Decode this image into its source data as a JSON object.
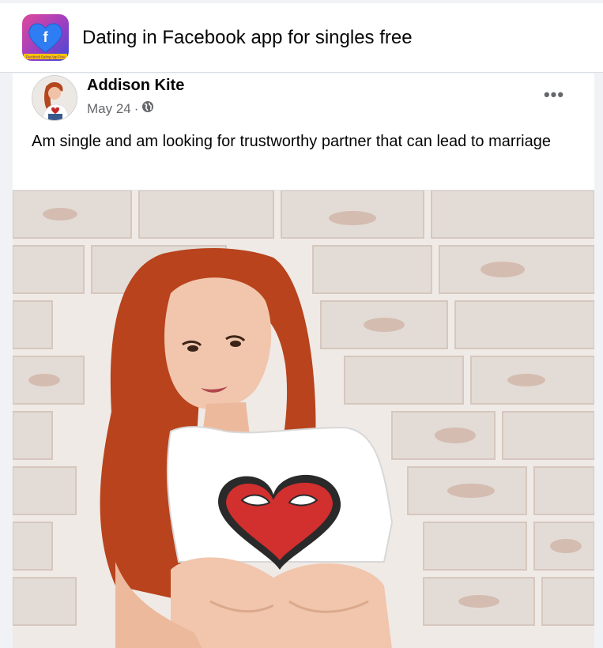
{
  "group": {
    "title": "Dating in Facebook app for singles free",
    "logo_caption": "Facebook Dating App Free",
    "logo_letter": "f"
  },
  "post": {
    "author": "Addison Kite",
    "date": "May 24",
    "separator": "·",
    "privacy_icon": "globe-icon",
    "more_label": "•••",
    "text": "Am single and am looking for trustworthy partner that can lead to marriage",
    "photo": {
      "content": "woman with red hair in white crop top with heart graphic in front of white painted brick wall"
    }
  },
  "colors": {
    "page_background": "#f0f2f5",
    "card_background": "#ffffff",
    "primary_text": "#050505",
    "secondary_text": "#65676b"
  }
}
